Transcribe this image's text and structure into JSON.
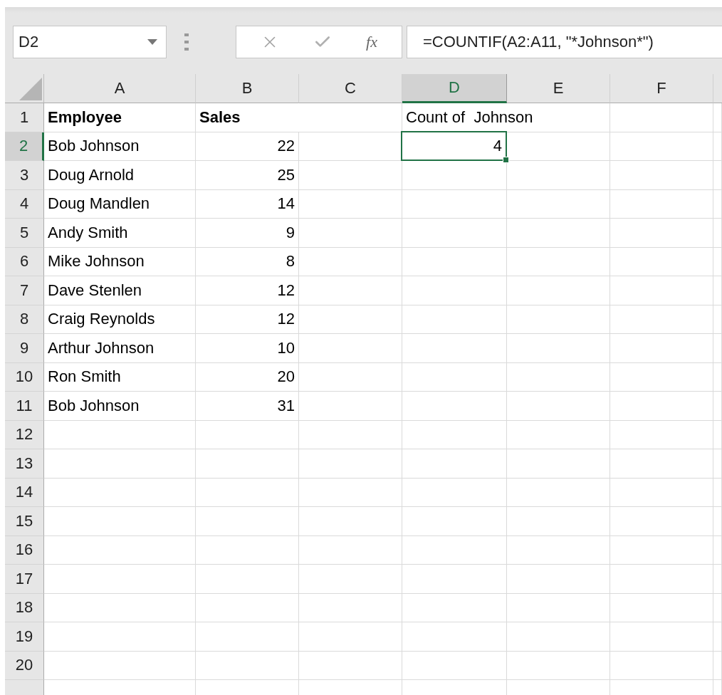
{
  "name_box": {
    "value": "D2"
  },
  "formula_bar": {
    "function_label": "fx",
    "formula": "=COUNTIF(A2:A11, \"*Johnson*\")"
  },
  "columns": [
    {
      "label": "A",
      "selected": false
    },
    {
      "label": "B",
      "selected": false
    },
    {
      "label": "C",
      "selected": false
    },
    {
      "label": "D",
      "selected": true
    },
    {
      "label": "E",
      "selected": false
    },
    {
      "label": "F",
      "selected": false
    }
  ],
  "rows": [
    {
      "label": "1",
      "selected": false,
      "cells": [
        {
          "text": "Employee",
          "kind": "text",
          "bold": true
        },
        {
          "text": "Sales",
          "kind": "text",
          "bold": true
        },
        null,
        {
          "text": "Count of  Johnson",
          "kind": "text",
          "bold": false
        }
      ]
    },
    {
      "label": "2",
      "selected": true,
      "cells": [
        {
          "text": "Bob Johnson",
          "kind": "text",
          "bold": false
        },
        {
          "text": "22",
          "kind": "number",
          "bold": false
        },
        null,
        {
          "text": "4",
          "kind": "number",
          "bold": false,
          "active": true
        }
      ]
    },
    {
      "label": "3",
      "selected": false,
      "cells": [
        {
          "text": "Doug Arnold",
          "kind": "text",
          "bold": false
        },
        {
          "text": "25",
          "kind": "number",
          "bold": false
        }
      ]
    },
    {
      "label": "4",
      "selected": false,
      "cells": [
        {
          "text": "Doug Mandlen",
          "kind": "text",
          "bold": false
        },
        {
          "text": "14",
          "kind": "number",
          "bold": false
        }
      ]
    },
    {
      "label": "5",
      "selected": false,
      "cells": [
        {
          "text": "Andy Smith",
          "kind": "text",
          "bold": false
        },
        {
          "text": "9",
          "kind": "number",
          "bold": false
        }
      ]
    },
    {
      "label": "6",
      "selected": false,
      "cells": [
        {
          "text": "Mike Johnson",
          "kind": "text",
          "bold": false
        },
        {
          "text": "8",
          "kind": "number",
          "bold": false
        }
      ]
    },
    {
      "label": "7",
      "selected": false,
      "cells": [
        {
          "text": "Dave Stenlen",
          "kind": "text",
          "bold": false
        },
        {
          "text": "12",
          "kind": "number",
          "bold": false
        }
      ]
    },
    {
      "label": "8",
      "selected": false,
      "cells": [
        {
          "text": "Craig Reynolds",
          "kind": "text",
          "bold": false
        },
        {
          "text": "12",
          "kind": "number",
          "bold": false
        }
      ]
    },
    {
      "label": "9",
      "selected": false,
      "cells": [
        {
          "text": "Arthur Johnson",
          "kind": "text",
          "bold": false
        },
        {
          "text": "10",
          "kind": "number",
          "bold": false
        }
      ]
    },
    {
      "label": "10",
      "selected": false,
      "cells": [
        {
          "text": "Ron Smith",
          "kind": "text",
          "bold": false
        },
        {
          "text": "20",
          "kind": "number",
          "bold": false
        }
      ]
    },
    {
      "label": "11",
      "selected": false,
      "cells": [
        {
          "text": "Bob Johnson",
          "kind": "text",
          "bold": false
        },
        {
          "text": "31",
          "kind": "number",
          "bold": false
        }
      ]
    },
    {
      "label": "12",
      "selected": false
    },
    {
      "label": "13",
      "selected": false
    },
    {
      "label": "14",
      "selected": false
    },
    {
      "label": "15",
      "selected": false
    },
    {
      "label": "16",
      "selected": false
    },
    {
      "label": "17",
      "selected": false
    },
    {
      "label": "18",
      "selected": false
    },
    {
      "label": "19",
      "selected": false
    },
    {
      "label": "20",
      "selected": false
    }
  ]
}
